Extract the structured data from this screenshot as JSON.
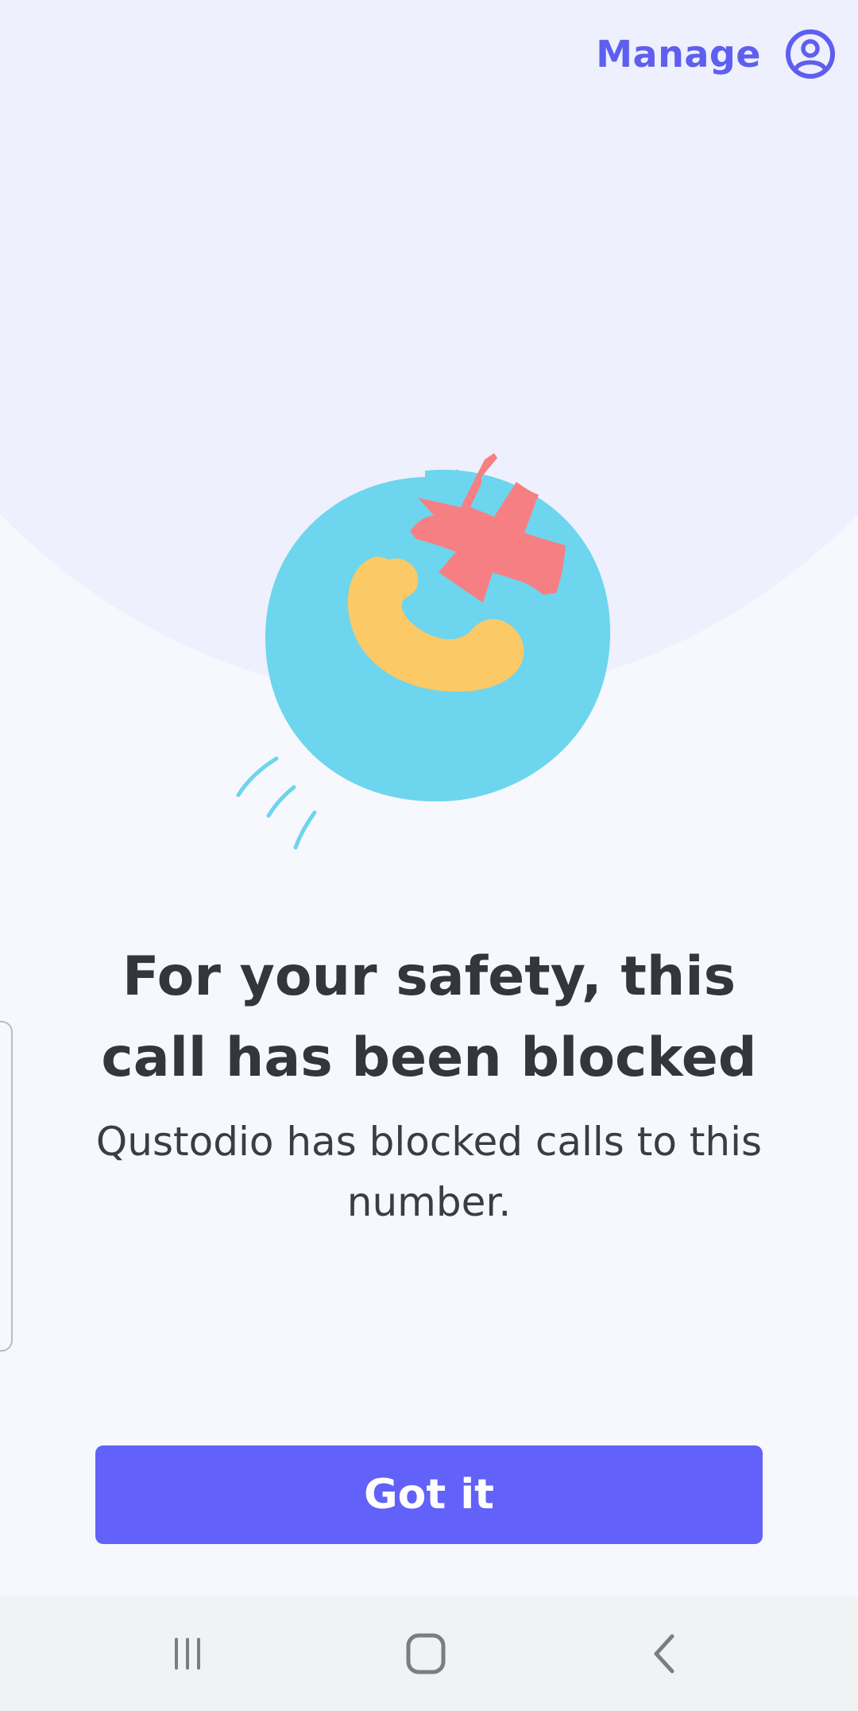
{
  "header": {
    "manage_label": "Manage",
    "account_icon": "account-circle-icon"
  },
  "illustration": {
    "icon": "blocked-call-illustration",
    "colors": {
      "circle": "#6dd6ee",
      "handset": "#fbc966",
      "cross": "#f67f83"
    }
  },
  "main": {
    "title": "For your safety, this call has been blocked",
    "message": "Qustodio has blocked calls to this number."
  },
  "actions": {
    "got_it_label": "Got it"
  },
  "nav_bar": {
    "recents_icon": "recent-apps-icon",
    "home_icon": "home-icon",
    "back_icon": "back-icon"
  },
  "colors": {
    "accent": "#6262fb",
    "header_text": "#5f5fef",
    "title_text": "#33373d",
    "background_top": "#eef0fd",
    "background": "#f6f8fd",
    "nav_bar": "#f1f2f4"
  }
}
